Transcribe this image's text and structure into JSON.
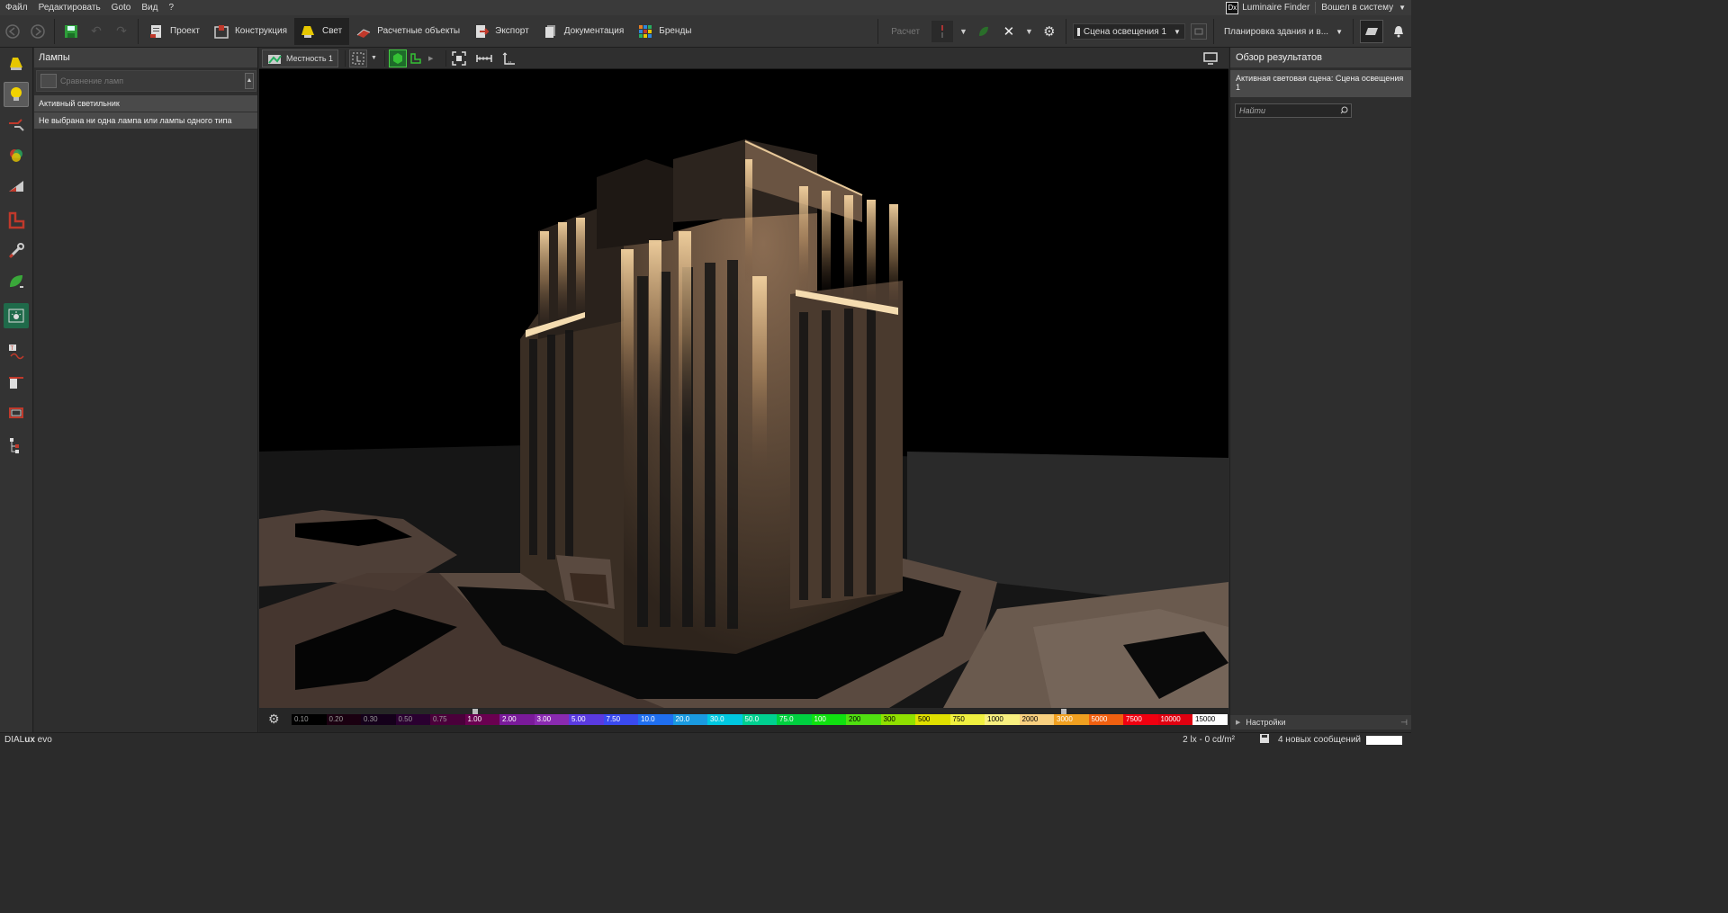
{
  "menu": {
    "items": [
      "Файл",
      "Редактировать",
      "Goto",
      "Вид",
      "?"
    ],
    "luminaire_finder": "Luminaire Finder",
    "logged_in": "Вошел в систему",
    "dx_logo": "Dx"
  },
  "toolbar": {
    "tabs": [
      {
        "label": "Проект",
        "icon": "project-icon",
        "color": "#c0392b"
      },
      {
        "label": "Конструкция",
        "icon": "construction-icon",
        "color": "#c0392b"
      },
      {
        "label": "Свет",
        "icon": "light-icon",
        "color": "#e6c700"
      },
      {
        "label": "Расчетные объекты",
        "icon": "calc-objects-icon",
        "color": "#c0392b"
      },
      {
        "label": "Экспорт",
        "icon": "export-icon",
        "color": "#c0392b"
      },
      {
        "label": "Документация",
        "icon": "documentation-icon",
        "color": "#aaaaaa"
      },
      {
        "label": "Бренды",
        "icon": "brands-icon",
        "color": "#2e86de"
      }
    ],
    "calc_label": "Расчет",
    "scene_select": "Сцена освещения 1",
    "layout_select": "Планировка здания и в..."
  },
  "lamp_panel": {
    "title": "Лампы",
    "compare_placeholder": "Сравнение ламп",
    "active_luminaire": "Активный светильник",
    "no_selection": "Не выбрана ни одна лампа или лампы одного типа"
  },
  "viewport": {
    "scene_tab": "Местность 1"
  },
  "scale": {
    "labels": [
      "0.10",
      "0.20",
      "0.30",
      "0.50",
      "0.75",
      "1.00",
      "2.00",
      "3.00",
      "5.00",
      "7.50",
      "10.0",
      "20.0",
      "30.0",
      "50.0",
      "75.0",
      "100",
      "200",
      "300",
      "500",
      "750",
      "1000",
      "2000",
      "3000",
      "5000",
      "7500",
      "10000",
      "15000"
    ],
    "colors": [
      "#000000",
      "#1a0010",
      "#14001a",
      "#2a0030",
      "#4a003a",
      "#6a0050",
      "#7a1a9a",
      "#8a2ab0",
      "#5a3ae0",
      "#3a4af0",
      "#1f6ff0",
      "#1a9ae0",
      "#00c8e0",
      "#00d090",
      "#00d040",
      "#10e010",
      "#50e010",
      "#90e000",
      "#e0e000",
      "#f0f040",
      "#f8f080",
      "#f8d080",
      "#f0a020",
      "#f06010",
      "#f00010",
      "#e00010",
      "#ffffff"
    ],
    "marker_low_index": 5,
    "marker_high_index": 22
  },
  "results_panel": {
    "title": "Обзор результатов",
    "active_scene": "Активная световая сцена: Сцена освещения 1",
    "search_placeholder": "Найти",
    "settings": "Настройки"
  },
  "status": {
    "brand_prefix": "DIAL",
    "brand_bold": "ux",
    "brand_suffix": " evo",
    "readout": "2 lx  -  0 cd/m²",
    "messages": "4 новых сообщений"
  }
}
